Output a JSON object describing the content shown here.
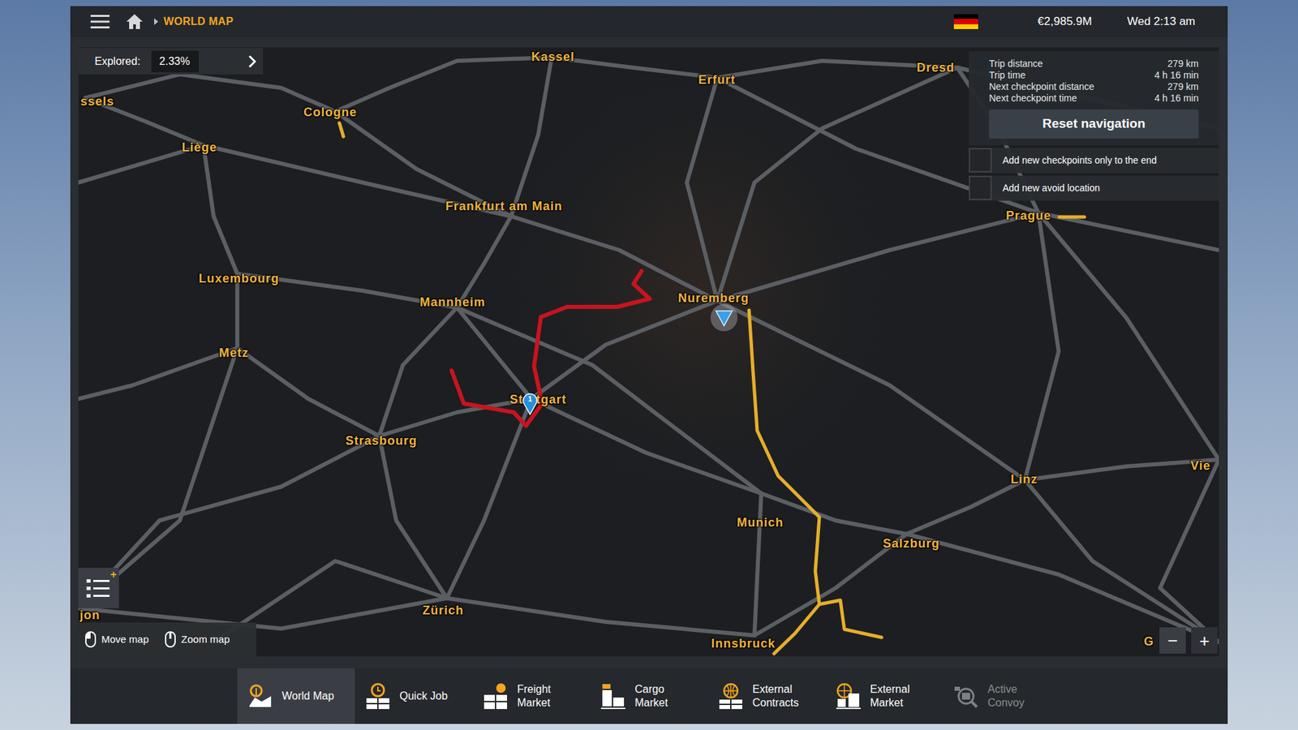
{
  "top_bar": {
    "title": "WORLD MAP",
    "money": "€2,985.9M",
    "time": "Wed 2:13 am"
  },
  "explored": {
    "label": "Explored:",
    "value": "2.33%"
  },
  "trip": {
    "rows": [
      {
        "label": "Trip distance",
        "value": "279 km"
      },
      {
        "label": "Trip time",
        "value": "4 h 16 min"
      },
      {
        "label": "Next checkpoint distance",
        "value": "279 km"
      },
      {
        "label": "Next checkpoint time",
        "value": "4 h 16 min"
      }
    ],
    "reset_button": "Reset navigation",
    "options": [
      {
        "label": "Add new checkpoints only to the end",
        "checked": false
      },
      {
        "label": "Add new avoid location",
        "checked": false
      }
    ]
  },
  "map": {
    "cities": [
      {
        "name": "Kassel"
      },
      {
        "name": "Erfurt"
      },
      {
        "name": "Dresd"
      },
      {
        "name": "ssels"
      },
      {
        "name": "Cologne"
      },
      {
        "name": "Liège"
      },
      {
        "name": "Frankfurt am Main"
      },
      {
        "name": "Luxembourg"
      },
      {
        "name": "Mannheim"
      },
      {
        "name": "Nuremberg"
      },
      {
        "name": "Prague"
      },
      {
        "name": "Metz"
      },
      {
        "name": "Stuttgart"
      },
      {
        "name": "Strasbourg"
      },
      {
        "name": "Linz"
      },
      {
        "name": "Vie"
      },
      {
        "name": "Munich"
      },
      {
        "name": "Salzburg"
      },
      {
        "name": "Zürich"
      },
      {
        "name": "Innsbruck"
      },
      {
        "name": "jon"
      },
      {
        "name": "G"
      }
    ],
    "checkpoint": {
      "label": "1"
    }
  },
  "hints": [
    {
      "label": "Move map"
    },
    {
      "label": "Zoom map"
    }
  ],
  "zoom": {
    "out": "−",
    "in": "+"
  },
  "nav": [
    {
      "lines": [
        "World Map"
      ],
      "selected": true,
      "disabled": false
    },
    {
      "lines": [
        "Quick Job"
      ],
      "selected": false,
      "disabled": false
    },
    {
      "lines": [
        "Freight",
        "Market"
      ],
      "selected": false,
      "disabled": false
    },
    {
      "lines": [
        "Cargo",
        "Market"
      ],
      "selected": false,
      "disabled": false
    },
    {
      "lines": [
        "External",
        "Contracts"
      ],
      "selected": false,
      "disabled": false
    },
    {
      "lines": [
        "External",
        "Market"
      ],
      "selected": false,
      "disabled": false
    },
    {
      "lines": [
        "Active",
        "Convoy"
      ],
      "selected": false,
      "disabled": true
    }
  ]
}
